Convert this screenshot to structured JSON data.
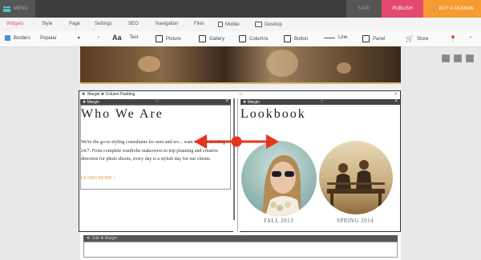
{
  "topbar": {
    "menu_label": "MENU",
    "save_label": "SAVE",
    "publish_label": "PUBLISH",
    "domain_label": "BUY A DOMAIN"
  },
  "tabs": [
    {
      "label": "Widgets"
    },
    {
      "label": "Style"
    },
    {
      "label": "Page"
    },
    {
      "label": "Settings"
    },
    {
      "label": "SEO"
    },
    {
      "label": "Navigation"
    },
    {
      "label": "Files"
    },
    {
      "label": "Mobile"
    },
    {
      "label": "Desktop"
    }
  ],
  "toolbar": {
    "borders_label": "Borders",
    "popular_label": "Popular",
    "text_label": "Text",
    "picture_label": "Picture",
    "gallery_label": "Gallery",
    "columns_label": "Columns",
    "button_label": "Button",
    "line_label": "Line",
    "panel_label": "Panel",
    "store_label": "Store"
  },
  "section": {
    "header_label": "Margin  ✥ Column Padding",
    "left_bar_label": "Margin",
    "right_bar_label": "Margin",
    "handle": "::::",
    "close": "×"
  },
  "left": {
    "heading": "Who We Are",
    "body": "We're the go-to styling consultants for men and wo... want to look amazing 24/7. From complete wardrobe makeovers to trip planning and creative direction for photo shoots, every day is a stylish day for our clients.",
    "link": "LEARN MORE >"
  },
  "right": {
    "heading": "Lookbook",
    "captions": [
      "FALL 2013",
      "SPRING 2014"
    ]
  },
  "bottom": {
    "bar_label": "Edit  ✥ Margin"
  },
  "colors": {
    "accent_pink": "#e44a6e",
    "accent_orange": "#f79a2f",
    "arrow_red": "#e8331c",
    "link_orange": "#e89a3a"
  }
}
